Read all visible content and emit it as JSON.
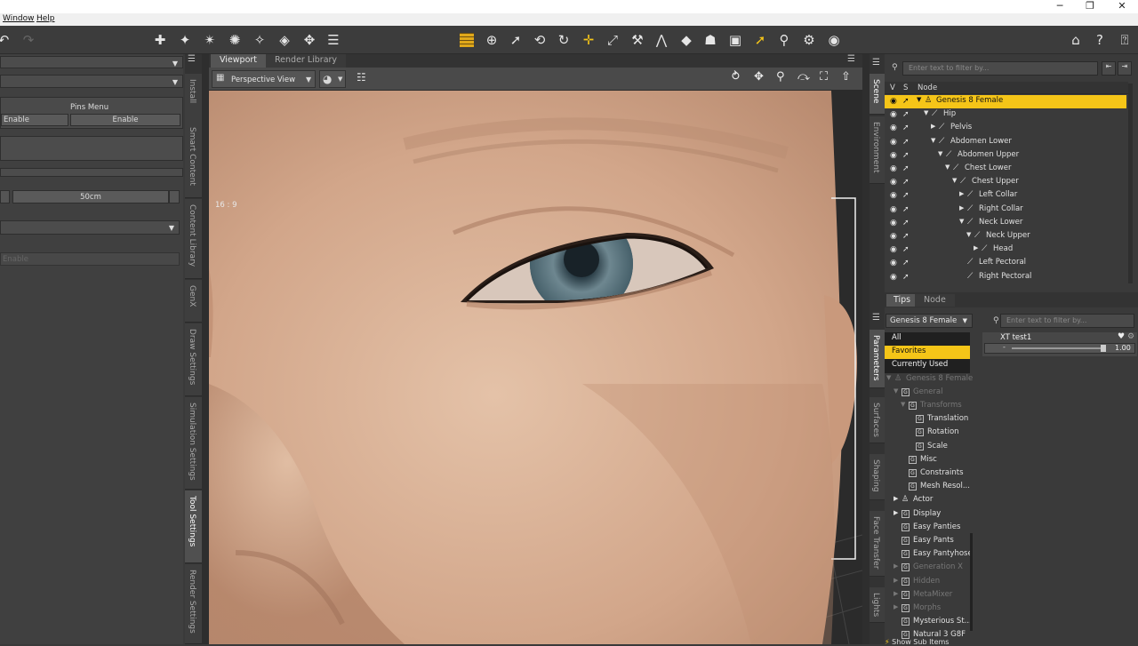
{
  "window_controls": {
    "minimize": "─",
    "maximize": "❐",
    "close": "✕"
  },
  "menu": {
    "items": [
      "Window",
      "Help"
    ]
  },
  "left_panel": {
    "pins_menu": "Pins Menu",
    "enable_left": "Enable",
    "enable_right": "Enable",
    "distance_value": "50cm",
    "disabled_field": "Enable",
    "vertical_tabs": [
      "Install",
      "Smart Content",
      "Content Library",
      "GenX",
      "Draw Settings",
      "Simulation Settings",
      "Tool Settings",
      "Render Settings"
    ]
  },
  "viewport": {
    "tabs": [
      "Viewport",
      "Render Library"
    ],
    "view_label": "Perspective View",
    "aspect_label": "16 : 9"
  },
  "right_vertical_tabs_top": [
    "Scene",
    "Environment"
  ],
  "right_vertical_tabs_bottom": [
    "Parameters",
    "Surfaces",
    "Shaping",
    "Face Transfer",
    "Lights"
  ],
  "scene": {
    "filter_placeholder": "Enter text to filter by...",
    "col_v": "V",
    "col_s": "S",
    "col_node": "Node",
    "rows": [
      {
        "label": "Genesis 8 Female",
        "indent": 0,
        "tri": "▼",
        "selected": true,
        "figure": true
      },
      {
        "label": "Hip",
        "indent": 1,
        "tri": "▼"
      },
      {
        "label": "Pelvis",
        "indent": 2,
        "tri": "▶"
      },
      {
        "label": "Abdomen Lower",
        "indent": 2,
        "tri": "▼"
      },
      {
        "label": "Abdomen Upper",
        "indent": 3,
        "tri": "▼"
      },
      {
        "label": "Chest Lower",
        "indent": 4,
        "tri": "▼"
      },
      {
        "label": "Chest Upper",
        "indent": 5,
        "tri": "▼"
      },
      {
        "label": "Left Collar",
        "indent": 6,
        "tri": "▶"
      },
      {
        "label": "Right Collar",
        "indent": 6,
        "tri": "▶"
      },
      {
        "label": "Neck Lower",
        "indent": 6,
        "tri": "▼"
      },
      {
        "label": "Neck Upper",
        "indent": 7,
        "tri": "▼"
      },
      {
        "label": "Head",
        "indent": 8,
        "tri": "▶"
      },
      {
        "label": "Left Pectoral",
        "indent": 6,
        "tri": ""
      },
      {
        "label": "Right Pectoral",
        "indent": 6,
        "tri": ""
      }
    ]
  },
  "tips_tabs": [
    "Tips",
    "Node"
  ],
  "parameters": {
    "figure_select": "Genesis 8 Female",
    "filter_placeholder": "Enter text to filter by...",
    "list": [
      {
        "label": "All",
        "style": "dark",
        "indent": 0
      },
      {
        "label": "Favorites",
        "style": "sel",
        "indent": 0
      },
      {
        "label": "Currently Used",
        "style": "dark",
        "indent": 0
      },
      {
        "label": "Genesis 8 Female",
        "style": "dim",
        "indent": 0,
        "tri": "▼",
        "icon": "figure"
      },
      {
        "label": "General",
        "style": "dim",
        "indent": 1,
        "tri": "▼",
        "icon": "g"
      },
      {
        "label": "Transforms",
        "style": "dim",
        "indent": 2,
        "tri": "▼",
        "icon": "g"
      },
      {
        "label": "Translation",
        "style": "",
        "indent": 3,
        "icon": "g"
      },
      {
        "label": "Rotation",
        "style": "",
        "indent": 3,
        "icon": "g"
      },
      {
        "label": "Scale",
        "style": "",
        "indent": 3,
        "icon": "g"
      },
      {
        "label": "Misc",
        "style": "",
        "indent": 2,
        "icon": "g"
      },
      {
        "label": "Constraints",
        "style": "",
        "indent": 2,
        "icon": "g"
      },
      {
        "label": "Mesh Resol...",
        "style": "",
        "indent": 2,
        "icon": "g"
      },
      {
        "label": "Actor",
        "style": "",
        "indent": 1,
        "tri": "▶",
        "icon": "figure"
      },
      {
        "label": "Display",
        "style": "",
        "indent": 1,
        "tri": "▶",
        "icon": "g"
      },
      {
        "label": "Easy Panties",
        "style": "",
        "indent": 1,
        "icon": "g"
      },
      {
        "label": "Easy Pants",
        "style": "",
        "indent": 1,
        "icon": "g"
      },
      {
        "label": "Easy Pantyhose",
        "style": "",
        "indent": 1,
        "icon": "g"
      },
      {
        "label": "Generation X",
        "style": "dim",
        "indent": 1,
        "tri": "▶",
        "icon": "g"
      },
      {
        "label": "Hidden",
        "style": "dim",
        "indent": 1,
        "tri": "▶",
        "icon": "g"
      },
      {
        "label": "MetaMixer",
        "style": "dim",
        "indent": 1,
        "tri": "▶",
        "icon": "g"
      },
      {
        "label": "Morphs",
        "style": "dim",
        "indent": 1,
        "tri": "▶",
        "icon": "g"
      },
      {
        "label": "Mysterious St...",
        "style": "",
        "indent": 1,
        "icon": "g"
      },
      {
        "label": "Natural 3 G8F",
        "style": "",
        "indent": 1,
        "icon": "g"
      }
    ],
    "bottom_label": "Show Sub Items",
    "property": {
      "name": "XT test1",
      "value": "1.00",
      "slider_fraction": 1.0
    }
  }
}
